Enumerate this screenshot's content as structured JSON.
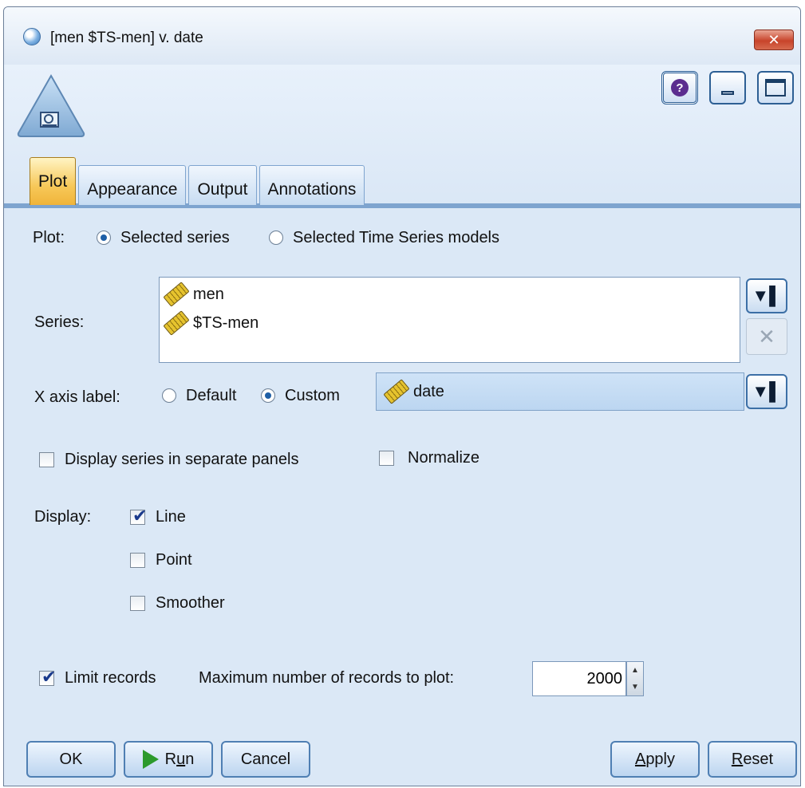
{
  "window": {
    "title": "[men $TS-men] v. date",
    "close_glyph": "✕"
  },
  "toolbar": {
    "help_glyph": "?"
  },
  "tabs": [
    "Plot",
    "Appearance",
    "Output",
    "Annotations"
  ],
  "plot": {
    "label": "Plot:",
    "options": [
      "Selected series",
      "Selected Time Series models"
    ],
    "selected": "Selected series"
  },
  "series": {
    "label": "Series:",
    "items": [
      "men",
      "$TS-men"
    ]
  },
  "xaxis": {
    "label": "X axis label:",
    "options": [
      "Default",
      "Custom"
    ],
    "selected": "Custom",
    "field": "date"
  },
  "separate_panels": {
    "label": "Display series in separate panels",
    "checked": false
  },
  "normalize": {
    "label": "Normalize",
    "checked": false
  },
  "display": {
    "label": "Display:",
    "line": {
      "label": "Line",
      "checked": true
    },
    "point": {
      "label": "Point",
      "checked": false
    },
    "smoother": {
      "label": "Smoother",
      "checked": false
    }
  },
  "limit": {
    "label": "Limit records",
    "checked": true,
    "max_label": "Maximum number of records to plot:",
    "value": "2000"
  },
  "buttons": {
    "ok": "OK",
    "run_pre": "R",
    "run_u": "u",
    "run_post": "n",
    "cancel": "Cancel",
    "apply_u": "A",
    "apply_post": "pply",
    "reset_u": "R",
    "reset_post": "eset"
  },
  "icons": {
    "app": "diamond-gem-icon",
    "node": "timeplot-node-icon",
    "field": "ruler-icon",
    "picker": "field-picker-icon",
    "remove": "remove-x-icon",
    "run": "play-icon"
  },
  "colors": {
    "accent_tab": "#f7c859",
    "background": "#dbe8f6",
    "run_green": "#2c9a2c"
  }
}
